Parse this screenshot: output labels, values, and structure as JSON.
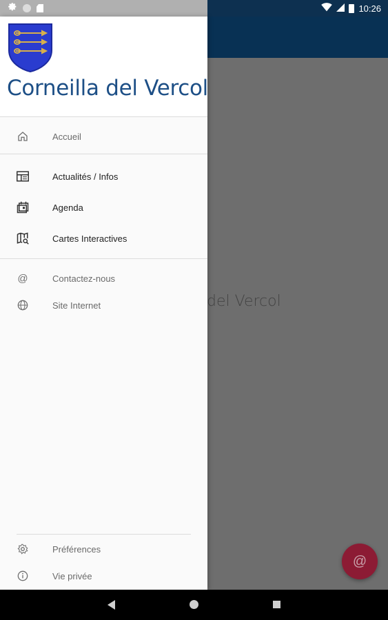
{
  "status_bar": {
    "time": "10:26",
    "left_icons": [
      "gear-icon",
      "circle-icon",
      "sd-card-icon"
    ],
    "right_icons": [
      "wifi-icon",
      "signal-icon",
      "battery-icon"
    ]
  },
  "background": {
    "title_fragment": "del Vercol"
  },
  "drawer": {
    "title": "Corneilla del Vercol",
    "sections": {
      "main": [
        {
          "label": "Accueil",
          "icon": "home-icon"
        }
      ],
      "content": [
        {
          "label": "Actualités / Infos",
          "icon": "news-icon"
        },
        {
          "label": "Agenda",
          "icon": "calendar-icon"
        },
        {
          "label": "Cartes Interactives",
          "icon": "map-search-icon"
        }
      ],
      "links": [
        {
          "label": "Contactez-nous",
          "icon": "at-sign-icon"
        },
        {
          "label": "Site Internet",
          "icon": "globe-icon"
        }
      ],
      "footer": [
        {
          "label": "Préférences",
          "icon": "settings-icon"
        },
        {
          "label": "Vie privée",
          "icon": "info-icon"
        }
      ]
    }
  },
  "fab": {
    "icon": "at-sign-icon",
    "glyph": "@"
  },
  "colors": {
    "brand_blue": "#1d4f86",
    "app_bar": "#083154",
    "fab": "#8c1b34",
    "crest_blue": "#2a3ccf",
    "crest_gold": "#d8b04a"
  }
}
